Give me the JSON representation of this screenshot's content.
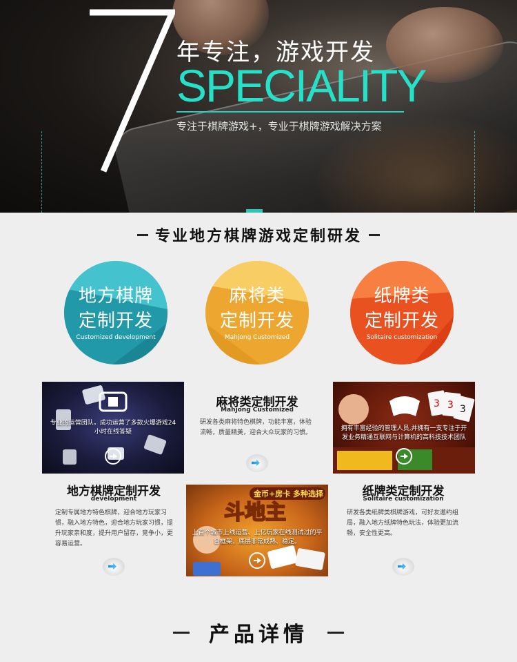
{
  "hero": {
    "big_number": "7",
    "title": "年专注，游戏开发",
    "speciality": "SPECIALITY",
    "subtitle": "专注于棋牌游戏+，专业于棋牌游戏解决方案"
  },
  "section1": {
    "heading": "专业地方棋牌游戏定制研发"
  },
  "circles": [
    {
      "line1": "地方棋牌",
      "line2": "定制开发",
      "en": "Customized development",
      "color_a": "#3bbac7",
      "color_b": "#1f95a3"
    },
    {
      "line1": "麻将类",
      "line2": "定制开发",
      "en": "Mahjong  Customized",
      "color_a": "#f6c552",
      "color_b": "#eba52e"
    },
    {
      "line1": "纸牌类",
      "line2": "定制开发",
      "en": "Solitaire customization",
      "color_a": "#f6793a",
      "color_b": "#e8481d"
    }
  ],
  "cards": {
    "mahjong_img": {
      "caption": "专业的运营团队，成功运营了多款火爆游戏24小时在线答疑"
    },
    "solitaire_img": {
      "caption": "拥有丰富经验的管理人员,并拥有一支专注于开发业务精通互联网与计算机的高科技技术团队",
      "card_digits": [
        "3",
        "3",
        "3"
      ]
    },
    "dizhu_img": {
      "caption": "上百个城市上线运营、上亿玩家在线测试过的平台框架，底层非常成熟、稳定。",
      "banner": "金币+房卡 多种选择",
      "game_name": "斗地主"
    }
  },
  "blocks": {
    "mahjong": {
      "title": "麻将类定制开发",
      "en": "Mahjong Customized",
      "body": "研发各类麻将特色棋牌，功能丰富，体验流畅，质量精美，迎合大众玩家的习惯。"
    },
    "local": {
      "title": "地方棋牌定制开发",
      "en": "development",
      "body": "定制专属地方特色棋牌，迎合地方玩家习惯，融入地方特色，迎合地方玩家习惯，提升玩家亲和度，提升用户留存，竞争小，更容易运营。"
    },
    "solitaire": {
      "title": "纸牌类定制开发",
      "en": "Solitaire customization",
      "body": "研发各类纸牌类棋牌游戏，可好友邀约组局，融入地方纸牌特色玩法，体验更加流畅，安全性更高。"
    }
  },
  "section2": {
    "heading": "产品详情"
  },
  "colors": {
    "accent": "#26e0c8",
    "teal": "#27c8b8",
    "arrow": "#1a8fd6"
  }
}
